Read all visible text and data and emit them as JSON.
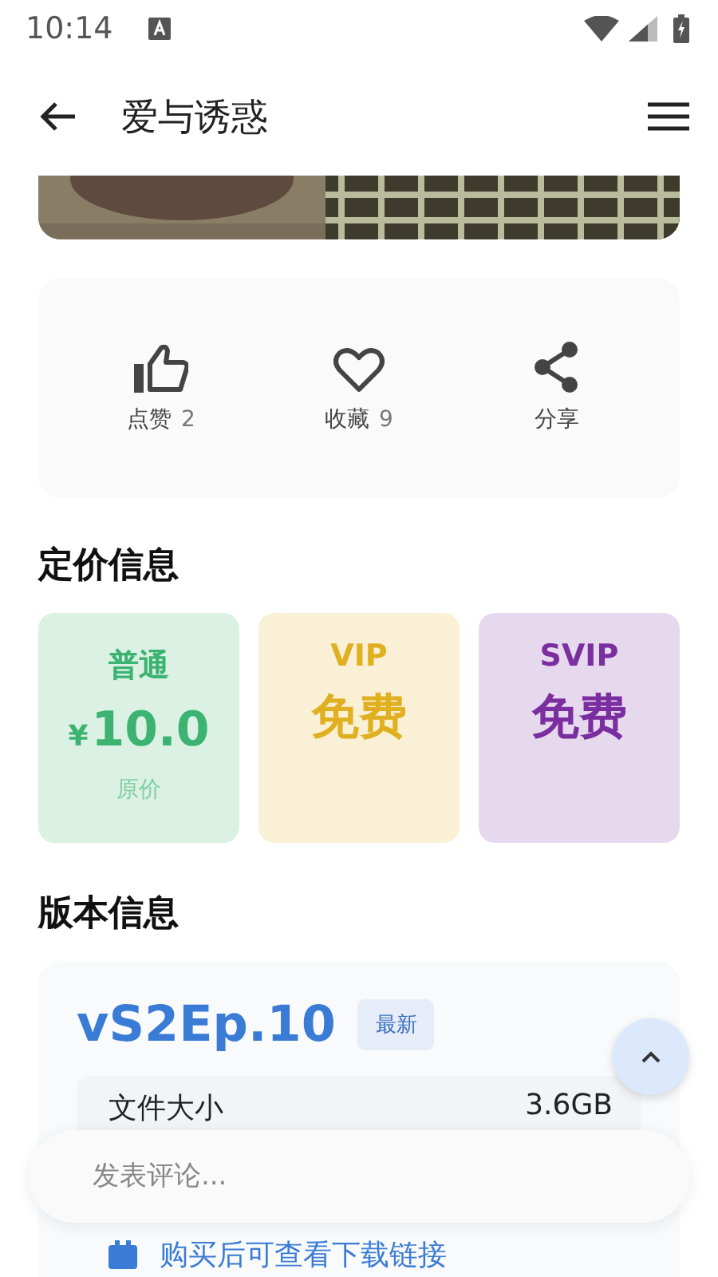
{
  "status_bar": {
    "time": "10:14"
  },
  "app_bar": {
    "title": "爱与诱惑"
  },
  "actions": [
    {
      "kind": "like",
      "label": "点赞",
      "count": "2"
    },
    {
      "kind": "favorite",
      "label": "收藏",
      "count": "9"
    },
    {
      "kind": "share",
      "label": "分享"
    }
  ],
  "pricing": {
    "heading": "定价信息",
    "tiers": [
      {
        "name": "普通",
        "currency": "¥",
        "price": "10.0",
        "note": "原价",
        "color": "#3cb371"
      },
      {
        "name": "VIP",
        "price": "免费",
        "color": "#e0b020"
      },
      {
        "name": "SVIP",
        "price": "免费",
        "color": "#7b2ea0"
      }
    ]
  },
  "version": {
    "heading": "版本信息",
    "name": "vS2Ep.10",
    "badge": "最新",
    "details": [
      {
        "label": "文件大小",
        "value": "3.6GB"
      }
    ],
    "notice": "购买后可查看下载链接"
  },
  "comment": {
    "placeholder": "发表评论..."
  }
}
